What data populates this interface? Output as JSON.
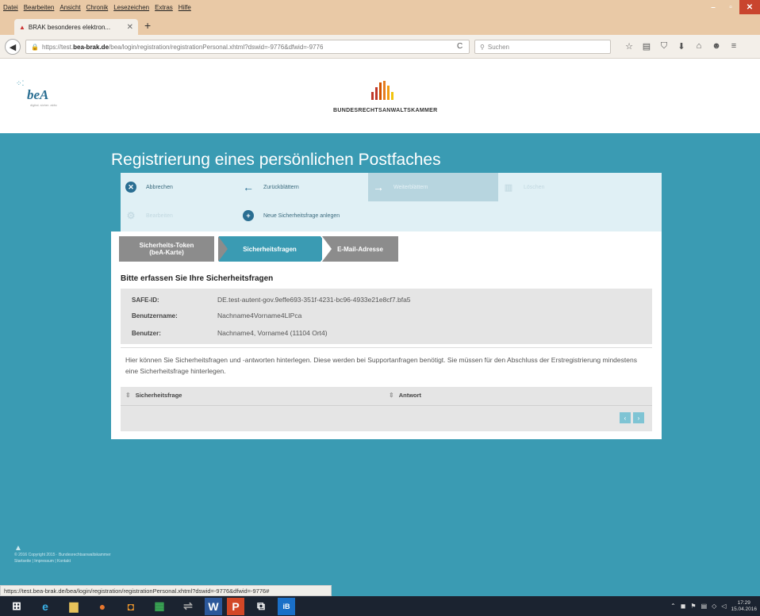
{
  "browser": {
    "menu": [
      "Datei",
      "Bearbeiten",
      "Ansicht",
      "Chronik",
      "Lesezeichen",
      "Extras",
      "Hilfe"
    ],
    "tab_title": "BRAK besonderes elektron...",
    "url_prefix": "https://test.",
    "url_domain": "bea-brak.de",
    "url_path": "/bea/login/registration/registrationPersonal.xhtml?dswid=-9776&dfwid=-9776",
    "search_placeholder": "Suchen",
    "status_url": "https://test.bea-brak.de/bea/login/registration/registrationPersonal.xhtml?dswid=-9776&dfwid=-9776#"
  },
  "header": {
    "bea_logo_text": "beA",
    "bea_tagline": "digital. sicher. aktiv.",
    "brak_name": "BUNDESRECHTSANWALTSKAMMER",
    "brak_bar_colors": [
      "#c0392b",
      "#c0392b",
      "#d35400",
      "#e67e22",
      "#f39c12",
      "#f1c40f"
    ]
  },
  "page": {
    "title": "Registrierung eines persönlichen Postfaches"
  },
  "actions": {
    "cancel": "Abbrechen",
    "back": "Zurückblättern",
    "next": "Weiterblättern",
    "delete": "Löschen",
    "edit": "Bearbeiten",
    "new_question": "Neue Sicherheitsfrage anlegen"
  },
  "steps": {
    "step1_line1": "Sicherheits-Token",
    "step1_line2": "(beA-Karte)",
    "step2": "Sicherheitsfragen",
    "step3": "E-Mail-Adresse"
  },
  "form": {
    "section_title": "Bitte erfassen Sie Ihre Sicherheitsfragen",
    "fields": [
      {
        "label": "SAFE-ID:",
        "value": "DE.test-autent-gov.9effe693-351f-4231-bc96-4933e21e8cf7.bfa5"
      },
      {
        "label": "Benutzername:",
        "value": "Nachname4Vorname4LIPca"
      },
      {
        "label": "Benutzer:",
        "value": "Nachname4, Vorname4 (11104 Ort4)"
      }
    ],
    "description": "Hier können Sie Sicherheitsfragen und -antworten hinterlegen. Diese werden bei Supportanfragen benötigt. Sie müssen für den Abschluss der Erstregistrierung mindestens eine Sicherheitsfrage hinterlegen.",
    "col_question": "Sicherheitsfrage",
    "col_answer": "Antwort",
    "pager_prev": "‹",
    "pager_next": "›"
  },
  "footer": {
    "line1": "© 2016 Copyright 2015 · Bundesrechtsanwaltskammer",
    "line2": "Startseite | Impressum | Kontakt"
  },
  "taskbar": {
    "time": "17:29",
    "date": "15.04.2016"
  }
}
